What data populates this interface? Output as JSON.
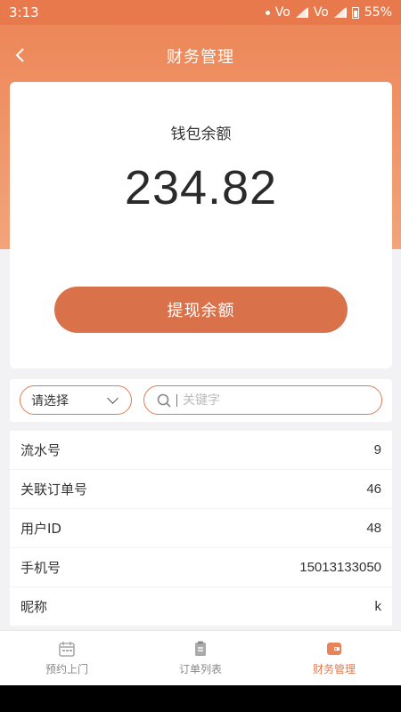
{
  "status_bar": {
    "time": "3:13",
    "network1": "Vo",
    "network2": "Vo",
    "battery": "55%"
  },
  "nav": {
    "title": "财务管理"
  },
  "wallet": {
    "label": "钱包余额",
    "amount": "234.82",
    "withdraw_label": "提现余额"
  },
  "filter": {
    "select_value": "请选择",
    "search_placeholder": "关键字"
  },
  "info_rows": [
    {
      "label": "流水号",
      "value": "9"
    },
    {
      "label": "关联订单号",
      "value": "46"
    },
    {
      "label": "用户ID",
      "value": "48"
    },
    {
      "label": "手机号",
      "value": "15013133050"
    },
    {
      "label": "昵称",
      "value": "k"
    }
  ],
  "tabbar": {
    "items": [
      {
        "label": "预约上门",
        "icon": "calendar-icon",
        "active": false
      },
      {
        "label": "订单列表",
        "icon": "clipboard-icon",
        "active": false
      },
      {
        "label": "财务管理",
        "icon": "wallet-icon",
        "active": true
      }
    ]
  },
  "colors": {
    "primary": "#e17a50",
    "button": "#d9714a",
    "header_top": "#ec8455",
    "header_bottom": "#f2a47b"
  }
}
